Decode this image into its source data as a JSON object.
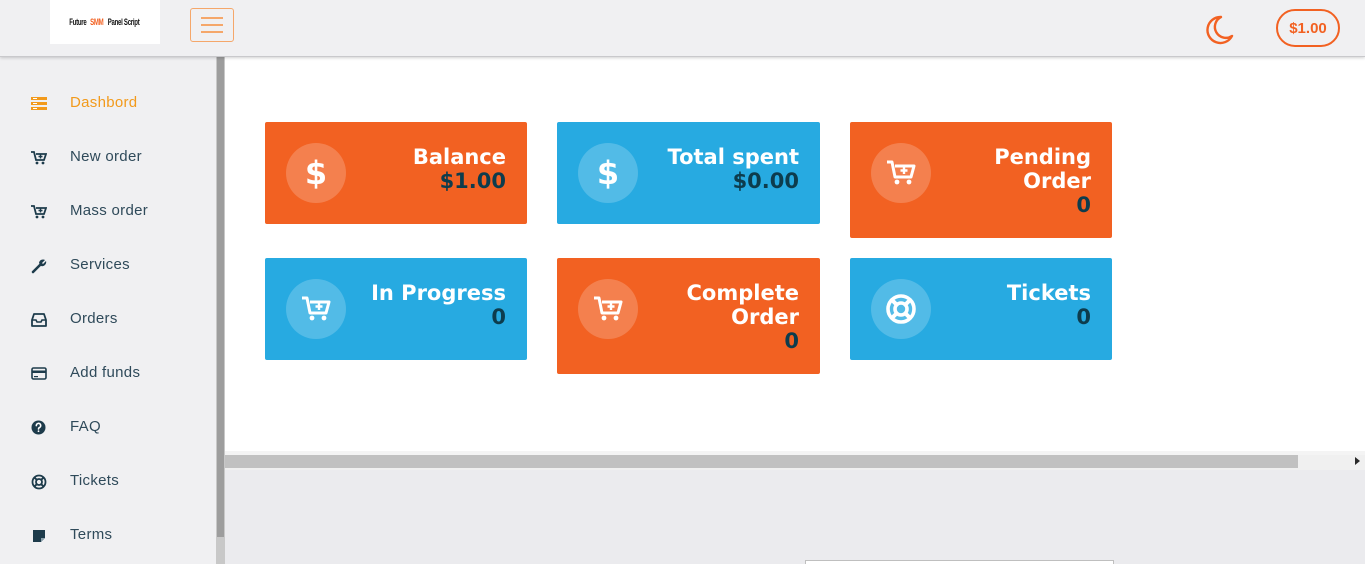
{
  "header": {
    "logo": {
      "before": "Future ",
      "highlight": "SMM",
      "after": " Panel Script"
    },
    "balance": "$1.00"
  },
  "sidebar": {
    "items": [
      {
        "label": "Dashbord",
        "icon": "dashboard-icon"
      },
      {
        "label": "New order",
        "icon": "cart-plus-icon"
      },
      {
        "label": "Mass order",
        "icon": "cart-plus-icon"
      },
      {
        "label": "Services",
        "icon": "wrench-icon"
      },
      {
        "label": "Orders",
        "icon": "inbox-icon"
      },
      {
        "label": "Add funds",
        "icon": "credit-card-icon"
      },
      {
        "label": "FAQ",
        "icon": "question-circle-icon"
      },
      {
        "label": "Tickets",
        "icon": "life-ring-icon"
      },
      {
        "label": "Terms",
        "icon": "note-icon"
      }
    ]
  },
  "cards": [
    {
      "title": "Balance",
      "value": "$1.00",
      "icon": "dollar-icon",
      "color": "#f26122"
    },
    {
      "title": "Total spent",
      "value": "$0.00",
      "icon": "dollar-icon",
      "color": "#27aae1"
    },
    {
      "title_line1": "Pending",
      "title_line2": "Order",
      "value": "0",
      "icon": "cart-plus-icon",
      "color": "#f26122"
    },
    {
      "title": "In Progress",
      "value": "0",
      "icon": "cart-plus-icon",
      "color": "#27aae1"
    },
    {
      "title_line1": "Complete",
      "title_line2": "Order",
      "value": "0",
      "icon": "cart-plus-icon",
      "color": "#f26122"
    },
    {
      "title": "Tickets",
      "value": "0",
      "icon": "life-ring-icon",
      "color": "#27aae1"
    }
  ],
  "colors": {
    "accent_orange": "#f26122",
    "accent_blue": "#27aae1",
    "active_nav": "#f29a1c",
    "value_text": "#0d3c4d"
  }
}
